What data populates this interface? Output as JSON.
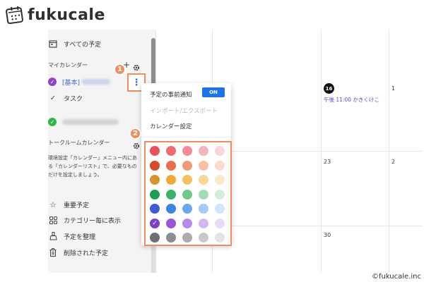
{
  "brand": {
    "name": "fukucale",
    "copyright": "©fukucale.inc"
  },
  "sidebar": {
    "all_events": "すべての予定",
    "my_calendar_label": "マイカレンダー",
    "basic_calendar": "[基本]",
    "tasks": "タスク",
    "talkroom_label": "トークルームカレンダー",
    "help_text": "環境設定「カレンダー」メニュー内にある「カレンダーリスト」で、必要なものだけを設定しましょう。",
    "bottom_items": [
      {
        "label": "重要予定",
        "icon": "star-icon"
      },
      {
        "label": "カテゴリー毎に表示",
        "icon": "grid-icon"
      },
      {
        "label": "予定を整理",
        "icon": "broom-icon"
      },
      {
        "label": "削除された予定",
        "icon": "trash-icon"
      }
    ]
  },
  "menu": {
    "notify_label": "予定の事前通知",
    "toggle_label": "ON",
    "import_export": "インポート/エクスポート",
    "calendar_settings": "カレンダー設定"
  },
  "badges": {
    "step1": "1",
    "step2": "2"
  },
  "calendar": {
    "today": "16",
    "event": "午後 11:00 かきくけこ",
    "row1_right": "1",
    "row2_left": "23",
    "row2_right": "2",
    "row3_left": "30"
  },
  "colors": {
    "accent_orange": "#ef8d5c",
    "toggle_blue": "#1a73e8",
    "event_purple": "#6a45c8",
    "selected_calendar": "#8e44c8",
    "talkroom_calendar": "#2eb84a",
    "palette": [
      [
        "#e8505b",
        "#ee6b6e",
        "#f28b94",
        "#f6b3bc",
        "#f9d6dc"
      ],
      [
        "#d94a2a",
        "#e8704b",
        "#f19a7a",
        "#f5bfa8",
        "#f9dccd"
      ],
      [
        "#d5962b",
        "#eda93a",
        "#f3c15e",
        "#f6d995",
        "#f9eac8"
      ],
      [
        "#1f9d55",
        "#39b36a",
        "#6ccb8b",
        "#a3ddb3",
        "#d0eed8"
      ],
      [
        "#3f5bd6",
        "#3d84e0",
        "#6aa9ef",
        "#a3cbf5",
        "#d2e6fb"
      ],
      [
        "#7d3fc8",
        "#9a55d9",
        "#b88ae5",
        "#d3b7ef",
        "#e9dbf7"
      ],
      [
        "#6e6e74",
        "#8c8c92",
        "#ababb0",
        "#c9c9cd",
        "#e3e3e6"
      ]
    ],
    "selected_swatch": "0,5"
  }
}
